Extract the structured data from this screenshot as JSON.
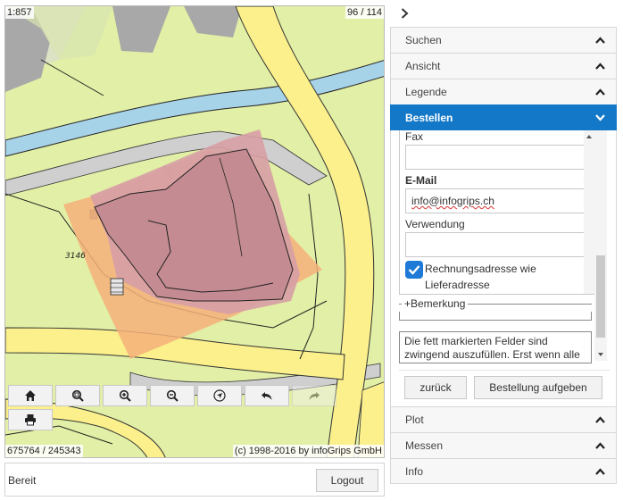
{
  "map": {
    "scale": "1:857",
    "page_count": "96 / 114",
    "parcel_number": "3146",
    "coordinates": "675764 / 245343",
    "copyright": "(c) 1998-2016 by infoGrips GmbH",
    "tools": [
      {
        "icon": "home-icon",
        "enabled": true
      },
      {
        "icon": "zoom-extent-icon",
        "enabled": true
      },
      {
        "icon": "zoom-in-icon",
        "enabled": true
      },
      {
        "icon": "zoom-out-icon",
        "enabled": true
      },
      {
        "icon": "navigate-icon",
        "enabled": true
      },
      {
        "icon": "undo-icon",
        "enabled": true
      },
      {
        "icon": "redo-icon",
        "enabled": false
      },
      {
        "icon": "print-icon",
        "enabled": true
      }
    ]
  },
  "status": {
    "text": "Bereit",
    "logout_label": "Logout"
  },
  "panel": {
    "collapse_icon": "chevron-right-icon",
    "accent_color": "#1478c8",
    "sections_top": [
      {
        "label": "Suchen"
      },
      {
        "label": "Ansicht"
      },
      {
        "label": "Legende"
      }
    ],
    "active_section": "Bestellen",
    "sections_bottom": [
      {
        "label": "Plot"
      },
      {
        "label": "Messen"
      },
      {
        "label": "Info"
      }
    ],
    "form": {
      "fax_label": "Fax",
      "fax_value": "",
      "email_label": "E-Mail",
      "email_value": "info@infogrips.ch",
      "usage_label": "Verwendung",
      "usage_value": "",
      "billing_checkbox_label": "Rechnungsadresse wie Lieferadresse",
      "billing_checked": true,
      "remark_legend": "+Bemerkung",
      "note_text": "Die fett markierten Felder sind zwingend auszufüllen. Erst wenn alle",
      "back_label": "zurück",
      "submit_label": "Bestellung aufgeben"
    }
  }
}
